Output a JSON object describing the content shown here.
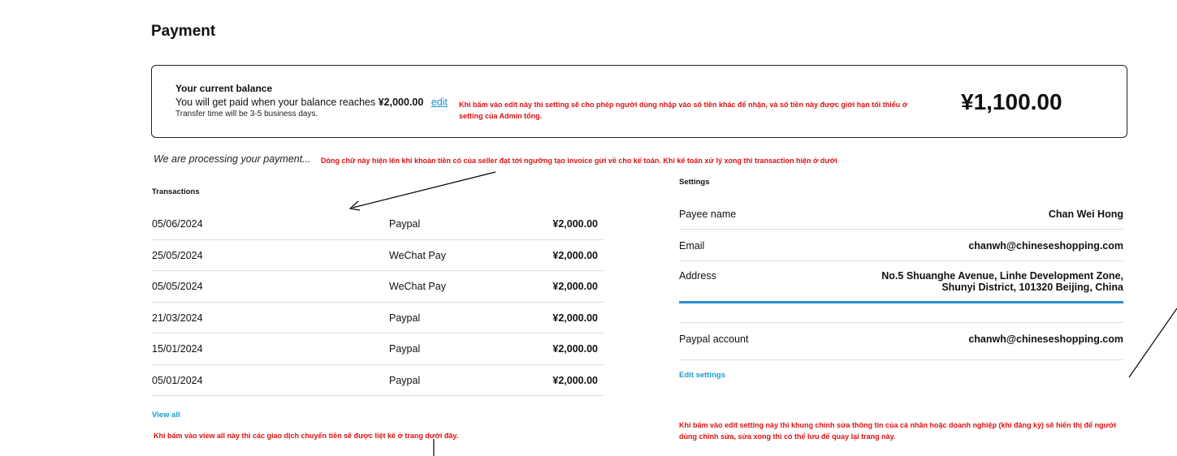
{
  "page": {
    "title": "Payment"
  },
  "balance": {
    "heading": "Your current balance",
    "payout_prefix": "You will get paid when your balance reaches",
    "payout_threshold": "¥2,000.00",
    "edit_label": "edit",
    "transfer_time": "Transfer time will be 3-5 business days.",
    "amount": "¥1,100.00"
  },
  "processing_text": "We are processing your payment...",
  "transactions": {
    "title": "Transactions",
    "rows": [
      {
        "date": "05/06/2024",
        "method": "Paypal",
        "amount": "¥2,000.00"
      },
      {
        "date": "25/05/2024",
        "method": "WeChat Pay",
        "amount": "¥2,000.00"
      },
      {
        "date": "05/05/2024",
        "method": "WeChat Pay",
        "amount": "¥2,000.00"
      },
      {
        "date": "21/03/2024",
        "method": "Paypal",
        "amount": "¥2,000.00"
      },
      {
        "date": "15/01/2024",
        "method": "Paypal",
        "amount": "¥2,000.00"
      },
      {
        "date": "05/01/2024",
        "method": "Paypal",
        "amount": "¥2,000.00"
      }
    ],
    "view_all_label": "View all"
  },
  "settings": {
    "title": "Settings",
    "payee_label": "Payee name",
    "payee_value": "Chan Wei Hong",
    "email_label": "Email",
    "email_value": "chanwh@chineseshopping.com",
    "address_label": "Address",
    "address_line1": "No.5 Shuanghe Avenue, Linhe Development Zone,",
    "address_line2": "Shunyi District, 101320 Beijing, China",
    "paypal_label": "Paypal account",
    "paypal_value": "chanwh@chineseshopping.com",
    "edit_label": "Edit settings"
  },
  "annotations": {
    "edit_note": "Khi bấm vào edit này thì setting sẽ cho phép người dùng nhập vào số tiền khác để nhận, và số tiền này được giới hạn tối thiểu ở setting của Admin tổng.",
    "processing_note": "Dòng chữ này hiện lên khi khoản tiền có của seller đạt tới ngưỡng tạo invoice gửi về cho kế toán. Khi kế toán xử lý xong thì transaction hiện ở dưới",
    "view_all_note": "Khi bấm vào view all này thì các giao dịch chuyển tiền sẽ được liệt kê ở trang dưới đây.",
    "edit_settings_note": "Khi bấm vào edit setting này thì khung chỉnh sửa thông tin của cá nhân hoặc doanh nghiệp (khi đăng ký) sẽ hiển thị để người dùng chỉnh sửa, sửa xong thì có thể lưu để quay lại trang này."
  },
  "colors": {
    "link": "#1a9ad6",
    "annotation": "#e01010",
    "divider": "#dddddd",
    "accent_line": "#2b8fd6"
  }
}
